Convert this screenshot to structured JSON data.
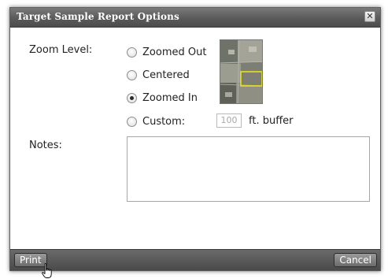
{
  "dialog": {
    "title": "Target Sample Report Options",
    "close_glyph": "✕"
  },
  "zoom": {
    "label": "Zoom Level:",
    "options": [
      {
        "label": "Zoomed Out",
        "checked": false
      },
      {
        "label": "Centered",
        "checked": false
      },
      {
        "label": "Zoomed In",
        "checked": true
      },
      {
        "label": "Custom:",
        "checked": false
      }
    ],
    "buffer_value": "100",
    "buffer_unit": "ft. buffer"
  },
  "notes": {
    "label": "Notes:",
    "value": ""
  },
  "footer": {
    "print_label": "Print",
    "cancel_label": "Cancel"
  },
  "colors": {
    "highlight_box": "#e8e01a",
    "titlebar": "#5a5a5a",
    "footer": "#4a4a4a"
  },
  "icons": {
    "cursor": "hand-pointer-icon",
    "close": "close-icon"
  }
}
